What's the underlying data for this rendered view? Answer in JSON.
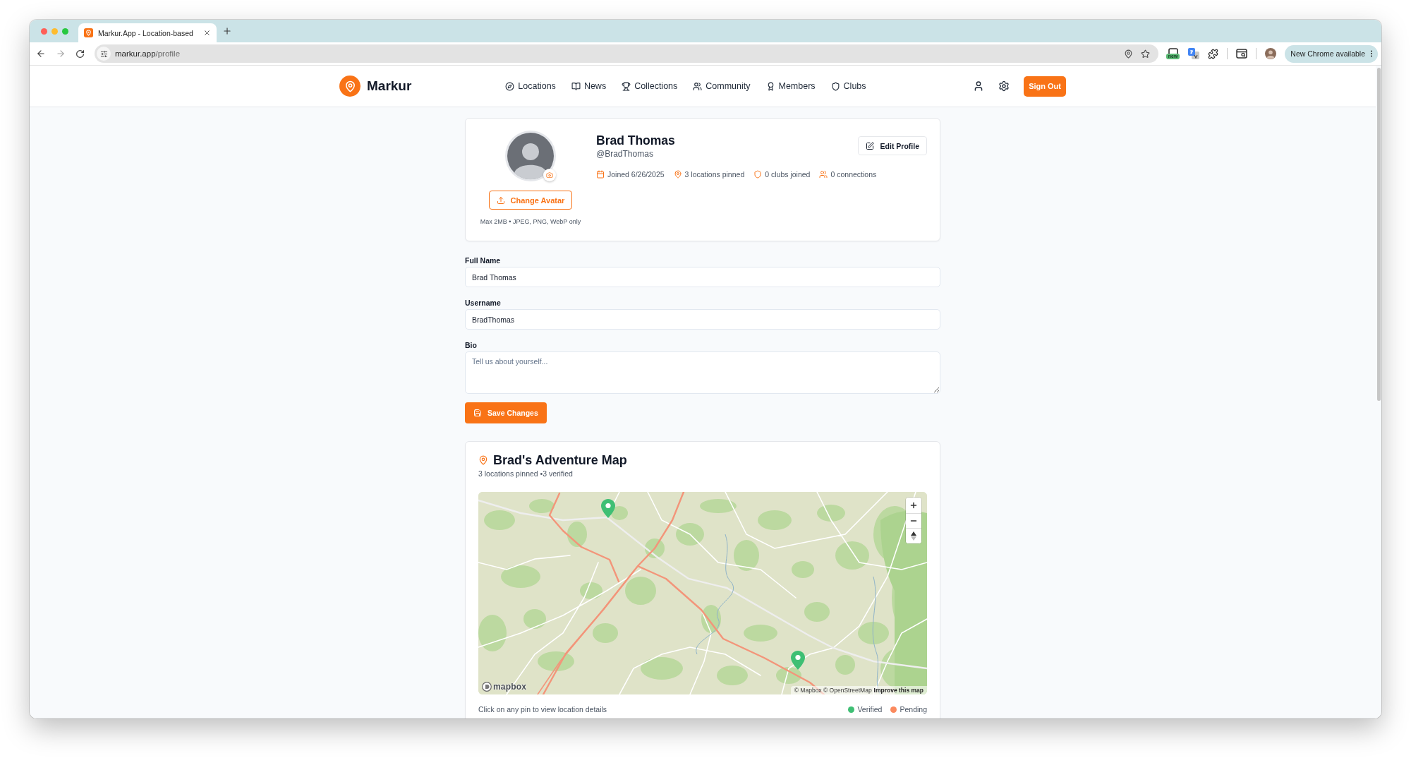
{
  "browser": {
    "tab": {
      "title": "Markur.App - Location-based",
      "selected": true
    },
    "url": {
      "host": "markur.app",
      "path": "/profile"
    },
    "extension_badge": "new",
    "update_button": "New Chrome available"
  },
  "header": {
    "brand": "Markur",
    "nav": [
      "Locations",
      "News",
      "Collections",
      "Community",
      "Members",
      "Clubs"
    ],
    "sign_out": "Sign Out"
  },
  "profile": {
    "name": "Brad Thomas",
    "handle": "@BradThomas",
    "change_avatar": "Change Avatar",
    "avatar_hint": "Max 2MB • JPEG, PNG, WebP only",
    "edit_button": "Edit Profile",
    "stats": [
      "Joined 6/26/2025",
      "3 locations pinned",
      "0 clubs joined",
      "0 connections"
    ]
  },
  "form": {
    "fields": [
      {
        "kind": "input",
        "label": "Full Name",
        "value": "Brad Thomas"
      },
      {
        "kind": "input",
        "label": "Username",
        "value": "BradThomas"
      },
      {
        "kind": "textarea",
        "label": "Bio",
        "placeholder": "Tell us about yourself..."
      }
    ],
    "save_button": "Save Changes"
  },
  "adventure_map": {
    "title": "Brad's Adventure Map",
    "summary": "3 locations pinned •3 verified",
    "pins": [
      {
        "color": "#3fbf74"
      },
      {
        "color": "#3fbf74"
      }
    ],
    "logo": "mapbox",
    "attribution": "© Mapbox © OpenStreetMap",
    "improve_link": "Improve this map",
    "hint": "Click on any pin to view location details",
    "legend": [
      {
        "label": "Verified",
        "color": "#3fbf74"
      },
      {
        "label": "Pending",
        "color": "#fb8a5e"
      }
    ]
  }
}
